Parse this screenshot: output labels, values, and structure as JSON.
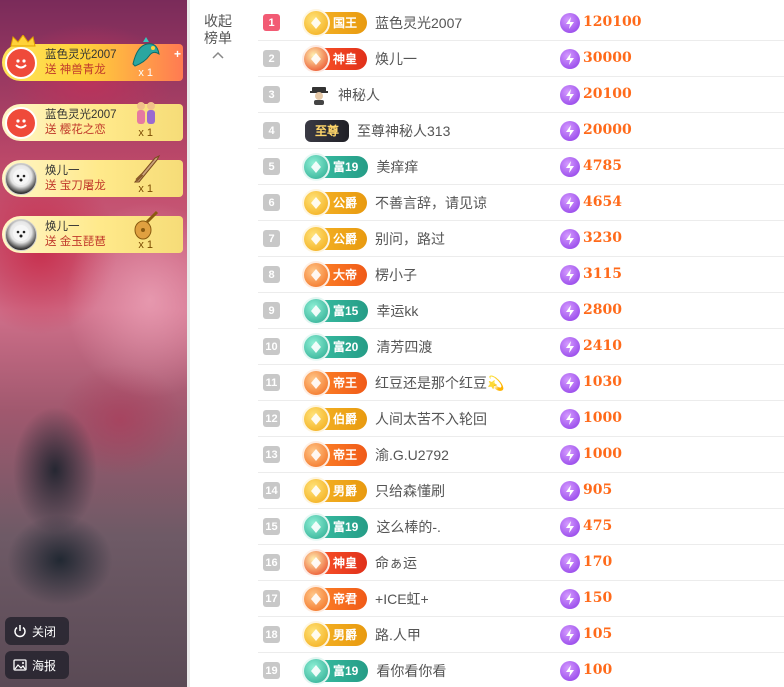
{
  "gifts": [
    {
      "user": "蓝色灵光2007",
      "send": "送",
      "gift": "神兽青龙",
      "count": "x 1",
      "avatar": "red-smiley-avatar",
      "item_icon": "dragon-icon"
    },
    {
      "user": "蓝色灵光2007",
      "send": "送",
      "gift": "樱花之恋",
      "count": "x 1",
      "avatar": "red-smiley-avatar",
      "item_icon": "couple-icon"
    },
    {
      "user": "焕儿一",
      "send": "送",
      "gift": "宝刀屠龙",
      "count": "x 1",
      "avatar": "dog-avatar",
      "item_icon": "sword-icon"
    },
    {
      "user": "焕儿一",
      "send": "送",
      "gift": "金玉琵琶",
      "count": "x 1",
      "avatar": "dog-avatar",
      "item_icon": "pipa-icon"
    }
  ],
  "controls": {
    "close_label": "关闭",
    "poster_label": "海报"
  },
  "collapse": {
    "line1": "收起",
    "line2": "榜单"
  },
  "ranking": [
    {
      "rank": "1",
      "badge": "国王",
      "badge_style": "gold",
      "name": "蓝色灵光2007",
      "value": "120100"
    },
    {
      "rank": "2",
      "badge": "神皇",
      "badge_style": "red",
      "name": "焕儿一",
      "value": "30000"
    },
    {
      "rank": "3",
      "badge": "",
      "badge_style": "mystery",
      "name": "神秘人",
      "value": "20100"
    },
    {
      "rank": "4",
      "badge": "至尊",
      "badge_style": "dark",
      "name": "至尊神秘人313",
      "value": "20000"
    },
    {
      "rank": "5",
      "badge": "富19",
      "badge_style": "teal",
      "name": "美痒痒",
      "value": "4785"
    },
    {
      "rank": "6",
      "badge": "公爵",
      "badge_style": "gold",
      "name": "不善言辞，请见谅",
      "value": "4654"
    },
    {
      "rank": "7",
      "badge": "公爵",
      "badge_style": "gold",
      "name": "别问，路过",
      "value": "3230"
    },
    {
      "rank": "8",
      "badge": "大帝",
      "badge_style": "orange",
      "name": "楞小子",
      "value": "3115"
    },
    {
      "rank": "9",
      "badge": "富15",
      "badge_style": "teal",
      "name": "幸运kk",
      "value": "2800"
    },
    {
      "rank": "10",
      "badge": "富20",
      "badge_style": "teal",
      "name": "清芳四渡",
      "value": "2410"
    },
    {
      "rank": "11",
      "badge": "帝王",
      "badge_style": "orange",
      "name": "红豆还是那个红豆💫",
      "value": "1030"
    },
    {
      "rank": "12",
      "badge": "伯爵",
      "badge_style": "gold",
      "name": "人间太苦不入轮回",
      "value": "1000"
    },
    {
      "rank": "13",
      "badge": "帝王",
      "badge_style": "orange",
      "name": "渝.G.U2792",
      "value": "1000"
    },
    {
      "rank": "14",
      "badge": "男爵",
      "badge_style": "gold",
      "name": "只给森懂刷",
      "value": "905"
    },
    {
      "rank": "15",
      "badge": "富19",
      "badge_style": "teal",
      "name": "这么棒的-.",
      "value": "475"
    },
    {
      "rank": "16",
      "badge": "神皇",
      "badge_style": "red",
      "name": "命ぁ运",
      "value": "170"
    },
    {
      "rank": "17",
      "badge": "帝君",
      "badge_style": "orange",
      "name": "+ICE虹+",
      "value": "150"
    },
    {
      "rank": "18",
      "badge": "男爵",
      "badge_style": "gold",
      "name": "路.人甲",
      "value": "105"
    },
    {
      "rank": "19",
      "badge": "富19",
      "badge_style": "teal",
      "name": "看你看你看",
      "value": "100"
    }
  ],
  "colors": {
    "accent_value": "#ff6a1a",
    "rank_top": "#f25b74",
    "coin": "#8a38e6"
  }
}
